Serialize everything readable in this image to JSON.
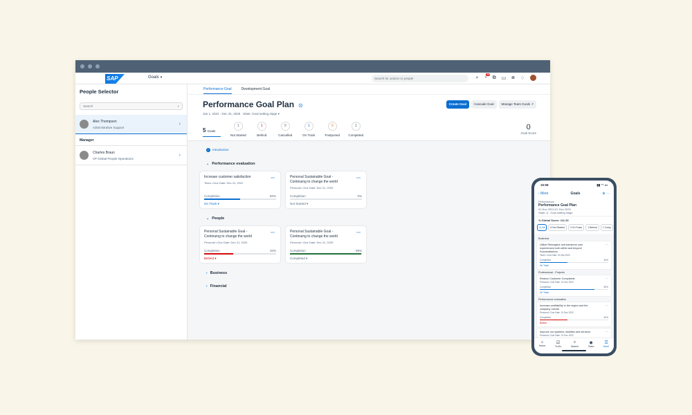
{
  "shell": {
    "logo": "SAP",
    "app_title": "Goals",
    "search_placeholder": "Search for actions or people",
    "notif_count": "25"
  },
  "sidebar": {
    "title": "People Selector",
    "search_placeholder": "Search",
    "selected": {
      "name": "Alex Thompson",
      "role": "Administrative Support"
    },
    "manager_label": "Manager",
    "manager": {
      "name": "Charles Braun",
      "role": "VP Global People Operations"
    }
  },
  "tabs": [
    "Performance Goal",
    "Development Goal"
  ],
  "page": {
    "title": "Performance Goal Plan",
    "date_range": "Jan 1, 2022 - Dec 31, 2025",
    "state": "State:  Goal setting stage",
    "buttons": {
      "create": "Create Goal",
      "cascade": "Cascade Goal",
      "manage": "Manage Team Goals"
    }
  },
  "stats": {
    "goals_count": "5",
    "goals_label": "Goals",
    "items": [
      {
        "value": "1",
        "label": "Not Started",
        "color": "#556b82"
      },
      {
        "value": "1",
        "label": "Behind",
        "color": "#d20a0a"
      },
      {
        "value": "0",
        "label": "Cancelled",
        "color": "#556b82"
      },
      {
        "value": "1",
        "label": "On Track",
        "color": "#0a6ed1"
      },
      {
        "value": "0",
        "label": "Postponed",
        "color": "#e9730c"
      },
      {
        "value": "1",
        "label": "Completed",
        "color": "#256f3a"
      }
    ],
    "score_value": "0",
    "score_label": "Goal Score"
  },
  "intro": "Introduction",
  "groups": [
    "Performance evaluation",
    "People",
    "Business",
    "Financial"
  ],
  "cards": [
    {
      "title": "Increase customer satisfaction",
      "meta": "Team • Due Date: Dec 31, 2022",
      "completion_label": "Completion",
      "pct": "50%",
      "fill": 0.5,
      "color": "#0a6ed1",
      "status": "On Track",
      "status_color": "#0a6ed1"
    },
    {
      "title": "Personal Sustainable Goal - Continuing to change the world",
      "meta": "Personal • Due Date: Dec 31, 2025",
      "completion_label": "Completion",
      "pct": "0%",
      "fill": 0,
      "color": "#0a6ed1",
      "status": "Not Started",
      "status_color": "#556b82"
    },
    {
      "title": "Personal Sustainable Goal - Continuing to change the world",
      "meta": "Personal • Due Date: Dec 31, 2025",
      "completion_label": "Completion",
      "pct": "40%",
      "fill": 0.4,
      "color": "#d20a0a",
      "status": "Behind",
      "status_color": "#d20a0a"
    },
    {
      "title": "Personal Sustainable Goal - Continuing to change the world",
      "meta": "Personal • Due Date: Dec 31, 2025",
      "completion_label": "Completion",
      "pct": "99%",
      "fill": 0.99,
      "color": "#256f3a",
      "status": "Completed",
      "status_color": "#556b82"
    }
  ],
  "phone": {
    "time": "15:58",
    "back": "More",
    "title": "Goals",
    "header_label": "Performance",
    "plan": "Performance Goal Plan",
    "dates": "01 Nov 2024-01 Dec 2025",
    "state": "State: A - Goal setting stage",
    "score": "% Global Score: 111.33",
    "filters": [
      "11 All",
      "6 Not Started",
      "3 On Track",
      "1 Behind",
      "1 Comp"
    ],
    "sections": [
      {
        "name": "Business",
        "cards": [
          {
            "title": "Utilize Reimagine and transform user experiences both within and beyond Successfactors",
            "meta": "Team • Due Date: 01 Mar 2022",
            "pct": "40%",
            "fill": 0.4,
            "color": "#0a6ed1",
            "status": "On Track",
            "status_color": "#0a6ed1"
          }
        ]
      },
      {
        "name": "Professional - Projects",
        "cards": [
          {
            "title": "Reduce Customer Complaints",
            "meta": "Personal • Due Date: 31 Dec 2022",
            "pct": "80%",
            "fill": 0.8,
            "color": "#0a6ed1",
            "status": "On Track",
            "status_color": "#0a6ed1"
          }
        ]
      },
      {
        "name": "Performance evaluation",
        "cards": [
          {
            "title": "Increase profitability in the region and the company overall",
            "meta": "Personal • Due Date: 31 Dec 2022",
            "pct": "40%",
            "fill": 0.4,
            "color": "#d20a0a",
            "status": "Behind",
            "status_color": "#d20a0a"
          },
          {
            "title": "Improve our systems, facilities and services",
            "meta": "Personal • Due Date: 31 Dec 2022",
            "pct": "",
            "fill": 0,
            "color": "#0a6ed1",
            "status": "",
            "status_color": "#556b82"
          }
        ]
      }
    ],
    "tabbar": [
      "Home",
      "To-Do",
      "Search",
      "Team",
      "More"
    ]
  }
}
